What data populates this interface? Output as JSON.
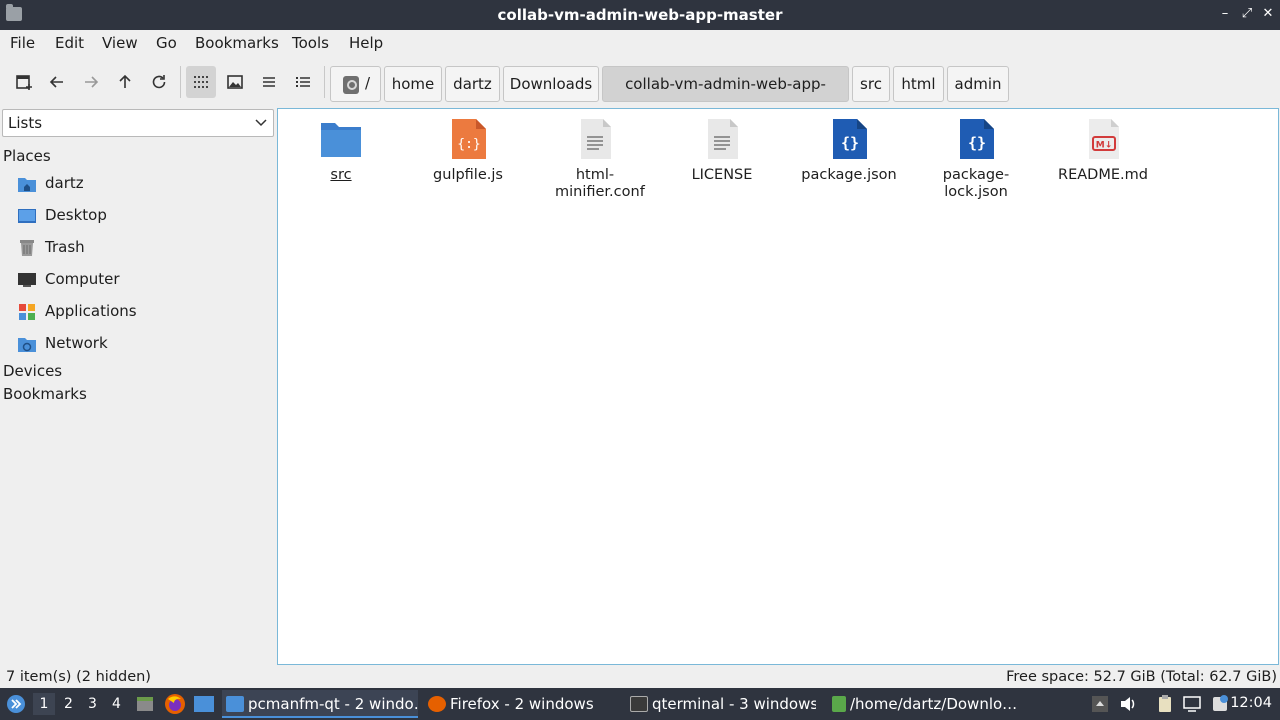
{
  "window": {
    "title": "collab-vm-admin-web-app-master"
  },
  "menu": [
    "File",
    "Edit",
    "View",
    "Go",
    "Bookmarks",
    "Tools",
    "Help"
  ],
  "breadcrumb": {
    "root": "/",
    "items": [
      "home",
      "dartz",
      "Downloads",
      "collab-vm-admin-web-app-master",
      "src",
      "html",
      "admin"
    ],
    "current_index": 3
  },
  "sidepane": {
    "mode": "Lists",
    "places_header": "Places",
    "places": [
      {
        "label": "dartz",
        "icon": "home-folder-icon"
      },
      {
        "label": "Desktop",
        "icon": "desktop-icon"
      },
      {
        "label": "Trash",
        "icon": "trash-icon"
      },
      {
        "label": "Computer",
        "icon": "computer-icon"
      },
      {
        "label": "Applications",
        "icon": "applications-icon"
      },
      {
        "label": "Network",
        "icon": "network-icon"
      }
    ],
    "devices_header": "Devices",
    "bookmarks_header": "Bookmarks"
  },
  "files": [
    {
      "name": "src",
      "type": "folder",
      "icon": "folder-icon"
    },
    {
      "name": "gulpfile.js",
      "type": "javascript",
      "icon": "javascript-file-icon"
    },
    {
      "name": "html-minifier.conf",
      "type": "text",
      "icon": "text-file-icon"
    },
    {
      "name": "LICENSE",
      "type": "text",
      "icon": "text-file-icon"
    },
    {
      "name": "package.json",
      "type": "json",
      "icon": "json-file-icon"
    },
    {
      "name": "package-lock.json",
      "type": "json",
      "icon": "json-file-icon"
    },
    {
      "name": "README.md",
      "type": "markdown",
      "icon": "markdown-file-icon"
    }
  ],
  "status": {
    "items": "7 item(s) (2 hidden)",
    "free_space": "Free space: 52.7 GiB (Total: 62.7 GiB)"
  },
  "taskbar": {
    "workspaces": [
      "1",
      "2",
      "3",
      "4"
    ],
    "tasks": [
      {
        "label": "pcmanfm-qt - 2 windo…",
        "icon": "folder-icon"
      },
      {
        "label": "Firefox - 2 windows",
        "icon": "firefox-icon"
      },
      {
        "label": "qterminal - 3 windows",
        "icon": "terminal-icon"
      },
      {
        "label": "/home/dartz/Downlo…",
        "icon": "text-editor-icon"
      }
    ],
    "clock": "12:04"
  },
  "colors": {
    "titlebar": "#2f343f",
    "folder": "#4a90d9",
    "json": "#1f5cb3",
    "javascript": "#ec7a3f",
    "selection_border": "#7ab8d8"
  }
}
